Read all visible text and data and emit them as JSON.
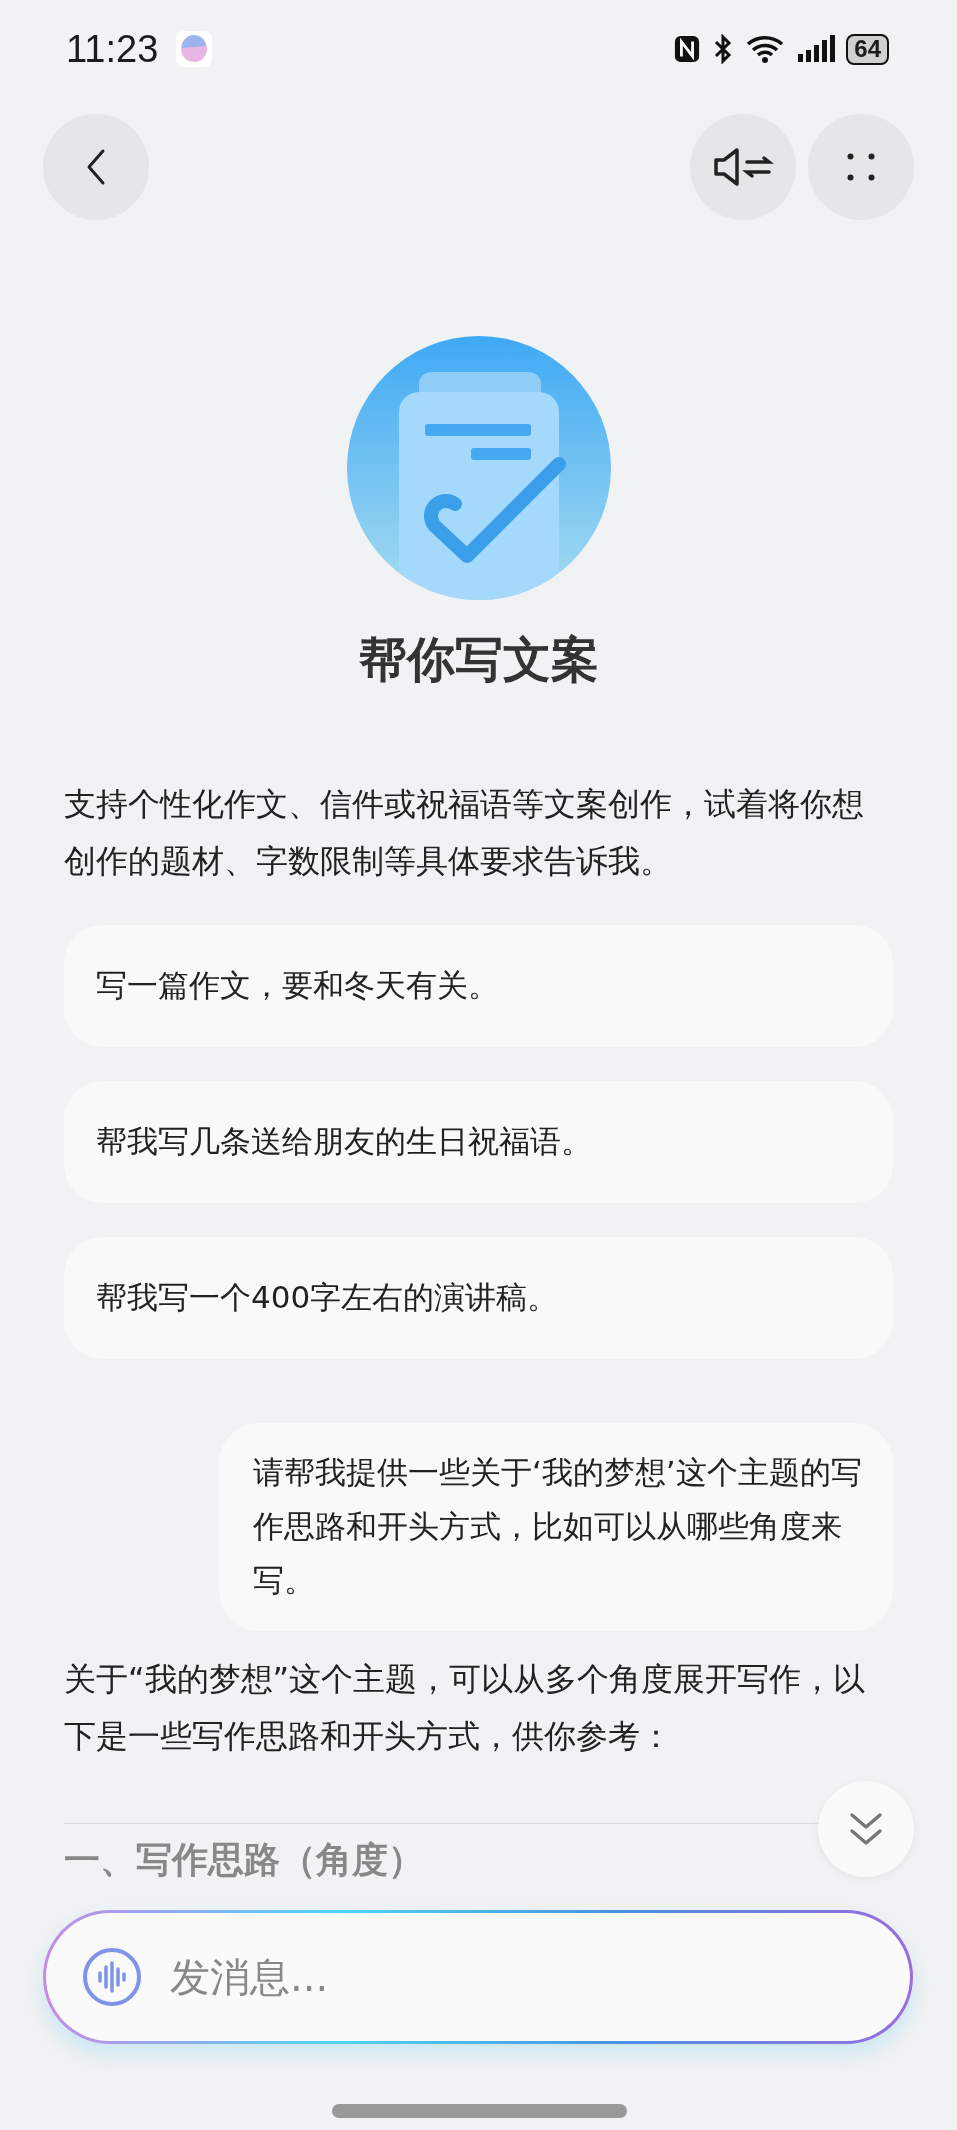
{
  "status_bar": {
    "time": "11:23",
    "battery": "64"
  },
  "intro": {
    "title": "帮你写文案",
    "description": "支持个性化作文、信件或祝福语等文案创作，试着将你想创作的题材、字数限制等具体要求告诉我。"
  },
  "suggestions": [
    "写一篇作文，要和冬天有关。",
    "帮我写几条送给朋友的生日祝福语。",
    "帮我写一个400字左右的演讲稿。"
  ],
  "messages": [
    {
      "kind": "user",
      "text": "请帮我提供一些关于‘我的梦想’这个主题的写作思路和开头方式，比如可以从哪些角度来写。"
    },
    {
      "kind": "assistant",
      "text": "关于“我的梦想”这个主题，可以从多个角度展开写作，以下是一些写作思路和开头方式，供你参考："
    },
    {
      "kind": "heading",
      "text": "一、写作思路（角度）"
    }
  ],
  "input": {
    "placeholder": "发消息..."
  }
}
